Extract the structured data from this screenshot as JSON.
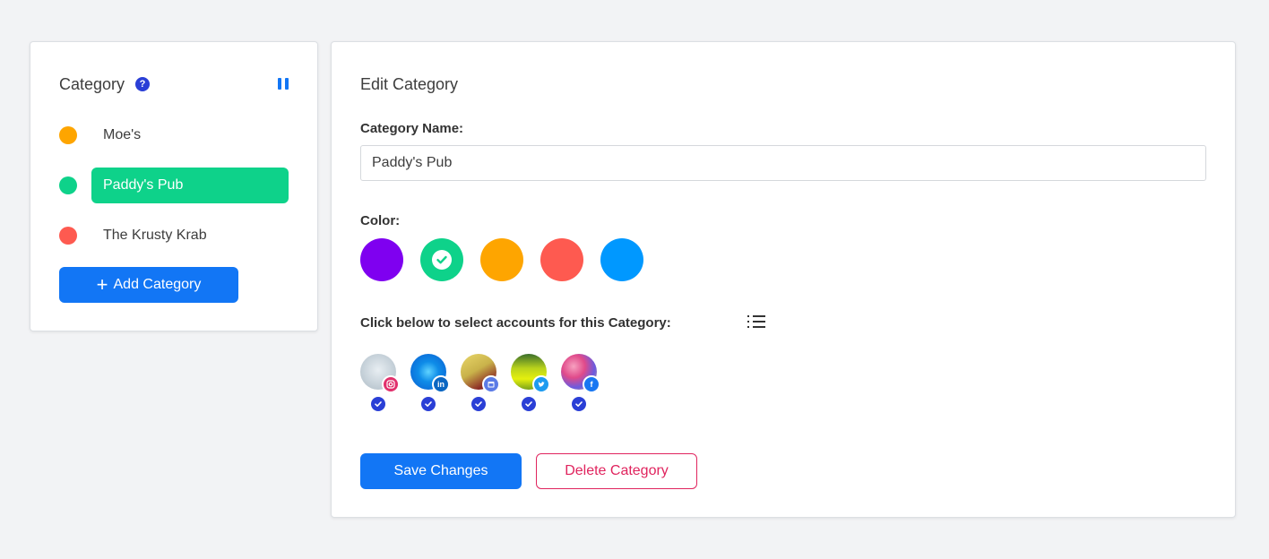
{
  "sidebar": {
    "title": "Category",
    "help_icon": "question-circle-icon",
    "collapse_icon": "pause-icon",
    "categories": [
      {
        "label": "Moe's",
        "color": "#fea500",
        "active": false
      },
      {
        "label": "Paddy's Pub",
        "color": "#0ed28a",
        "active": true
      },
      {
        "label": "The Krusty Krab",
        "color": "#fe5a50",
        "active": false
      }
    ],
    "add_label": "Add Category"
  },
  "editor": {
    "title": "Edit Category",
    "name_label": "Category Name:",
    "name_value": "Paddy's Pub",
    "color_label": "Color:",
    "colors": [
      {
        "hex": "#7f00f0",
        "selected": false
      },
      {
        "hex": "#0ed28a",
        "selected": true
      },
      {
        "hex": "#fea500",
        "selected": false
      },
      {
        "hex": "#fe5a50",
        "selected": false
      },
      {
        "hex": "#0098ff",
        "selected": false
      }
    ],
    "accounts_label": "Click below to select accounts for this Category:",
    "accounts": [
      {
        "network": "instagram",
        "badge_color": "#e1306c",
        "selected": true
      },
      {
        "network": "linkedin",
        "badge_color": "#0a66c2",
        "selected": true
      },
      {
        "network": "google-my-business",
        "badge_color": "#5b7be6",
        "selected": true
      },
      {
        "network": "twitter",
        "badge_color": "#1d9bf0",
        "selected": true
      },
      {
        "network": "facebook",
        "badge_color": "#1877f2",
        "selected": true
      }
    ],
    "save_label": "Save Changes",
    "delete_label": "Delete Category"
  },
  "colors": {
    "primary": "#1276f5",
    "danger": "#e0245e",
    "check": "#2a3fd6"
  }
}
